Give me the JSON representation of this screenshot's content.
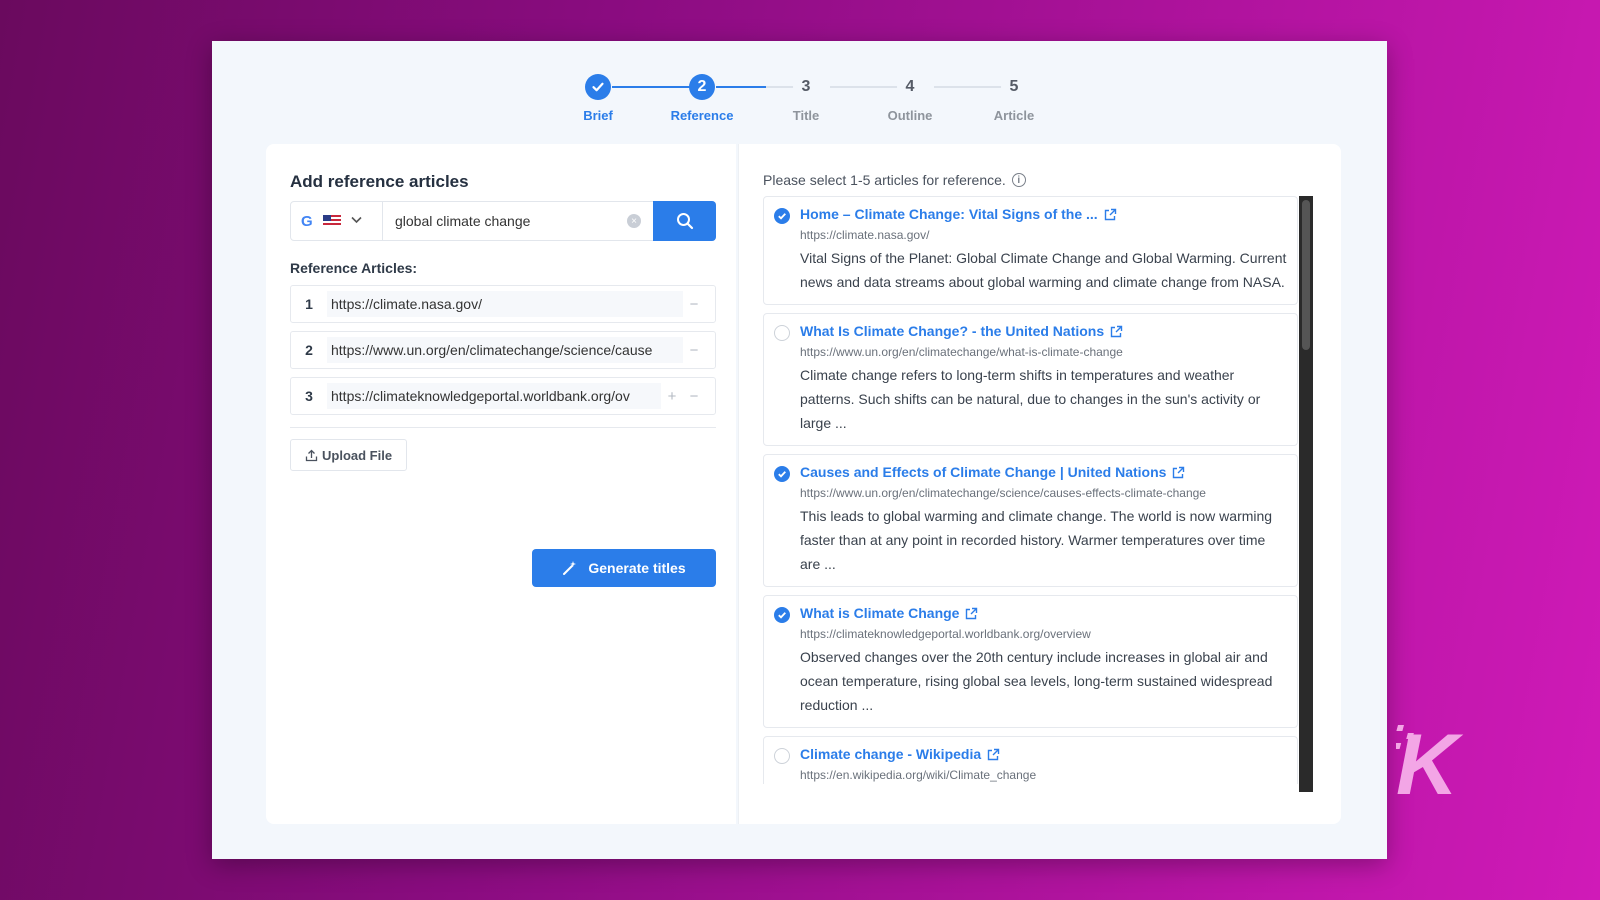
{
  "stepper": {
    "steps": [
      {
        "num": "1",
        "label": "Brief",
        "state": "done"
      },
      {
        "num": "2",
        "label": "Reference",
        "state": "active"
      },
      {
        "num": "3",
        "label": "Title",
        "state": "todo"
      },
      {
        "num": "4",
        "label": "Outline",
        "state": "todo"
      },
      {
        "num": "5",
        "label": "Article",
        "state": "todo"
      }
    ]
  },
  "left": {
    "heading": "Add reference articles",
    "search": {
      "engine_icon": "G",
      "value": "global climate change",
      "region": "us-flag-icon"
    },
    "ref_heading": "Reference Articles:",
    "refs": [
      {
        "num": "1",
        "url": "https://climate.nasa.gov/"
      },
      {
        "num": "2",
        "url": "https://www.un.org/en/climatechange/science/cause"
      },
      {
        "num": "3",
        "url": "https://climateknowledgeportal.worldbank.org/ov"
      }
    ],
    "upload_label": "Upload File",
    "generate_label": "Generate titles"
  },
  "right": {
    "instruction": "Please select 1-5 articles for reference.",
    "results": [
      {
        "checked": true,
        "title": "Home – Climate Change: Vital Signs of the ...",
        "url": "https://climate.nasa.gov/",
        "desc": "Vital Signs of the Planet: Global Climate Change and Global Warming. Current news and data streams about global warming and climate change from NASA."
      },
      {
        "checked": false,
        "title": "What Is Climate Change? - the United Nations",
        "url": "https://www.un.org/en/climatechange/what-is-climate-change",
        "desc": "Climate change refers to long-term shifts in temperatures and weather patterns. Such shifts can be natural, due to changes in the sun's activity or large ..."
      },
      {
        "checked": true,
        "title": "Causes and Effects of Climate Change | United Nations",
        "url": "https://www.un.org/en/climatechange/science/causes-effects-climate-change",
        "desc": "This leads to global warming and climate change. The world is now warming faster than at any point in recorded history. Warmer temperatures over time are ..."
      },
      {
        "checked": true,
        "title": "What is Climate Change",
        "url": "https://climateknowledgeportal.worldbank.org/overview",
        "desc": "Observed changes over the 20th century include increases in global air and ocean temperature, rising global sea levels, long-term sustained widespread reduction ..."
      },
      {
        "checked": false,
        "title": "Climate change - Wikipedia",
        "url": "https://en.wikipedia.org/wiki/Climate_change",
        "desc": ""
      }
    ]
  },
  "watermark": "K",
  "colors": {
    "accent": "#2b7de9",
    "bg_from": "#6a0a5e",
    "bg_to": "#d01ab8"
  }
}
